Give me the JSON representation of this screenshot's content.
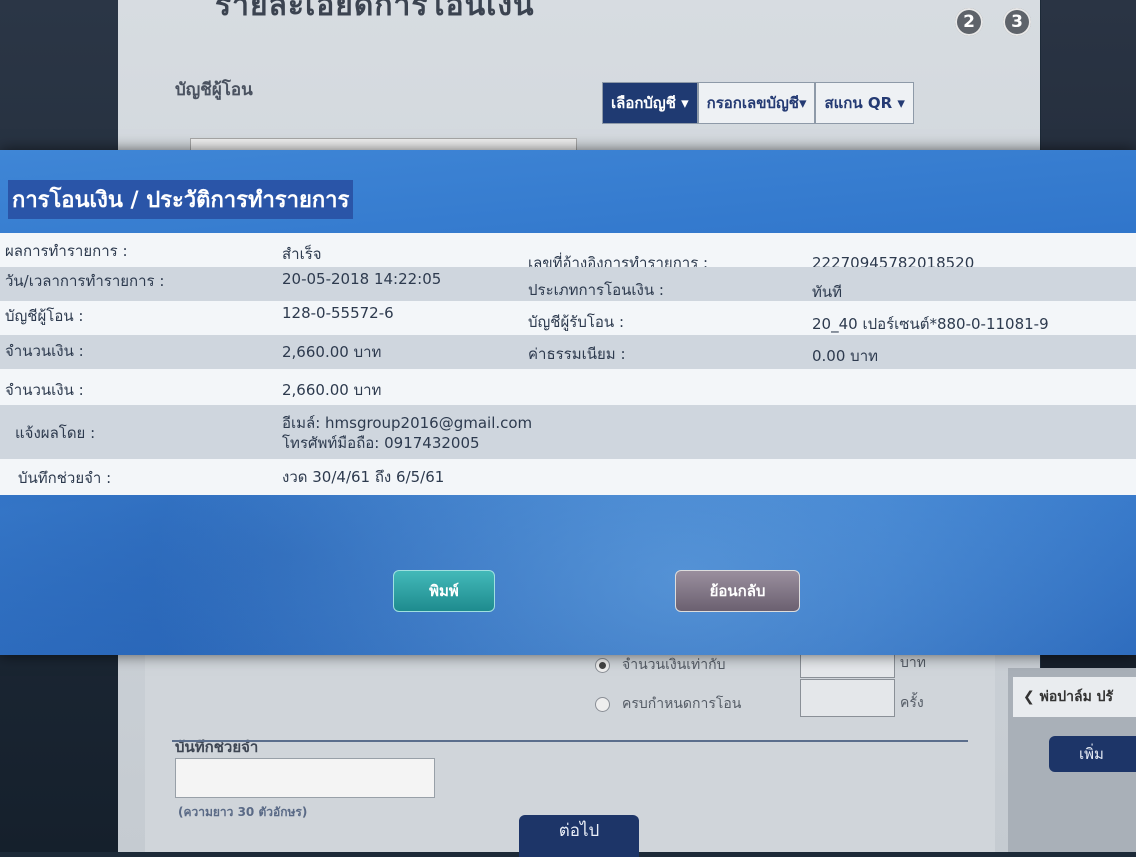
{
  "background": {
    "title": "รายละเอียดการโอนเงิน",
    "steps": [
      "2",
      "3"
    ],
    "from_account_label": "บัญชีผู้โอน",
    "account_tabs": [
      "เลือกบัญชี ▾",
      "กรอกเลขบัญชี▾",
      "สแกน QR ▾"
    ],
    "radio_equal_amount": "จำนวนเงินเท่ากับ",
    "radio_times": "ครบกำหนดการโอน",
    "unit_baht": "บาท",
    "unit_times": "ครั้ง",
    "memo_title": "บันทึกช่วยจำ",
    "memo_hint": "(ความยาว 30 ตัวอักษร)",
    "next_button": "ต่อไป",
    "right_back_link": "❮ พ่อปาล์ม ปรั",
    "right_add_button": "เพิ่ม"
  },
  "modal": {
    "title": "การโอนเงิน / ประวัติการทำรายการ",
    "rows": [
      {
        "label": "ผลการทำรายการ  :",
        "value": "สำเร็จ",
        "label2": "เลขที่อ้างอิงการทำรายการ  :",
        "value2": "22270945782018520"
      },
      {
        "label": "วัน/เวลาการทำรายการ  :",
        "value": "20-05-2018 14:22:05",
        "label2": "ประเภทการโอนเงิน  :",
        "value2": "ทันที"
      },
      {
        "label": "บัญชีผู้โอน  :",
        "value": "128-0-55572-6",
        "label2": "บัญชีผู้รับโอน  :",
        "value2": "20_40 เปอร์เซนต์*880-0-11081-9"
      },
      {
        "label": "จำนวนเงิน  :",
        "value": "2,660.00 บาท",
        "label2": "ค่าธรรมเนียม  :",
        "value2": "0.00 บาท"
      },
      {
        "label": "จำนวนเงิน  :",
        "value": "2,660.00 บาท"
      },
      {
        "label": "แจ้งผลโดย  :",
        "value": "อีเมล์: hmsgroup2016@gmail.com",
        "value_line2": "โทรศัพท์มือถือ: 0917432005"
      },
      {
        "label": "บันทึกช่วยจำ  :",
        "value": "งวด 30/4/61 ถึง 6/5/61"
      }
    ],
    "print_button": "พิมพ์",
    "back_button": "ย้อนกลับ"
  },
  "colors": {
    "modal_blue": "#2e73c9",
    "title_highlight": "#2a55a8",
    "print_button": "#2aa0a2",
    "back_button": "#7e7384"
  }
}
